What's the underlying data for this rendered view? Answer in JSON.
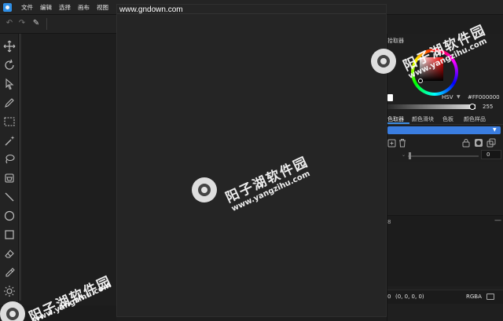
{
  "menubar": {
    "items": [
      "文件",
      "编辑",
      "选择",
      "画布",
      "视图"
    ]
  },
  "canvas": {
    "url_text": "www.gndown.com"
  },
  "right_panel": {
    "title_partial": "拾取器",
    "color_mode": "HSV",
    "hex_value": "#FF000000",
    "alpha_value": "255",
    "tabs": [
      "色取器",
      "颜色滑块",
      "色板",
      "颜色样品"
    ],
    "opacity_value": "0",
    "section2_label": "8",
    "coord_label": "0",
    "rgb_readout": "(0, 0, 0, 0)",
    "format_label": "RGBA"
  },
  "watermark": {
    "cn_text": "阳子湖软件园",
    "url_text": "www.yangzihu.com"
  },
  "colors": {
    "accent": "#3a7de0",
    "bg": "#1e1e1e",
    "panel": "#232323"
  }
}
